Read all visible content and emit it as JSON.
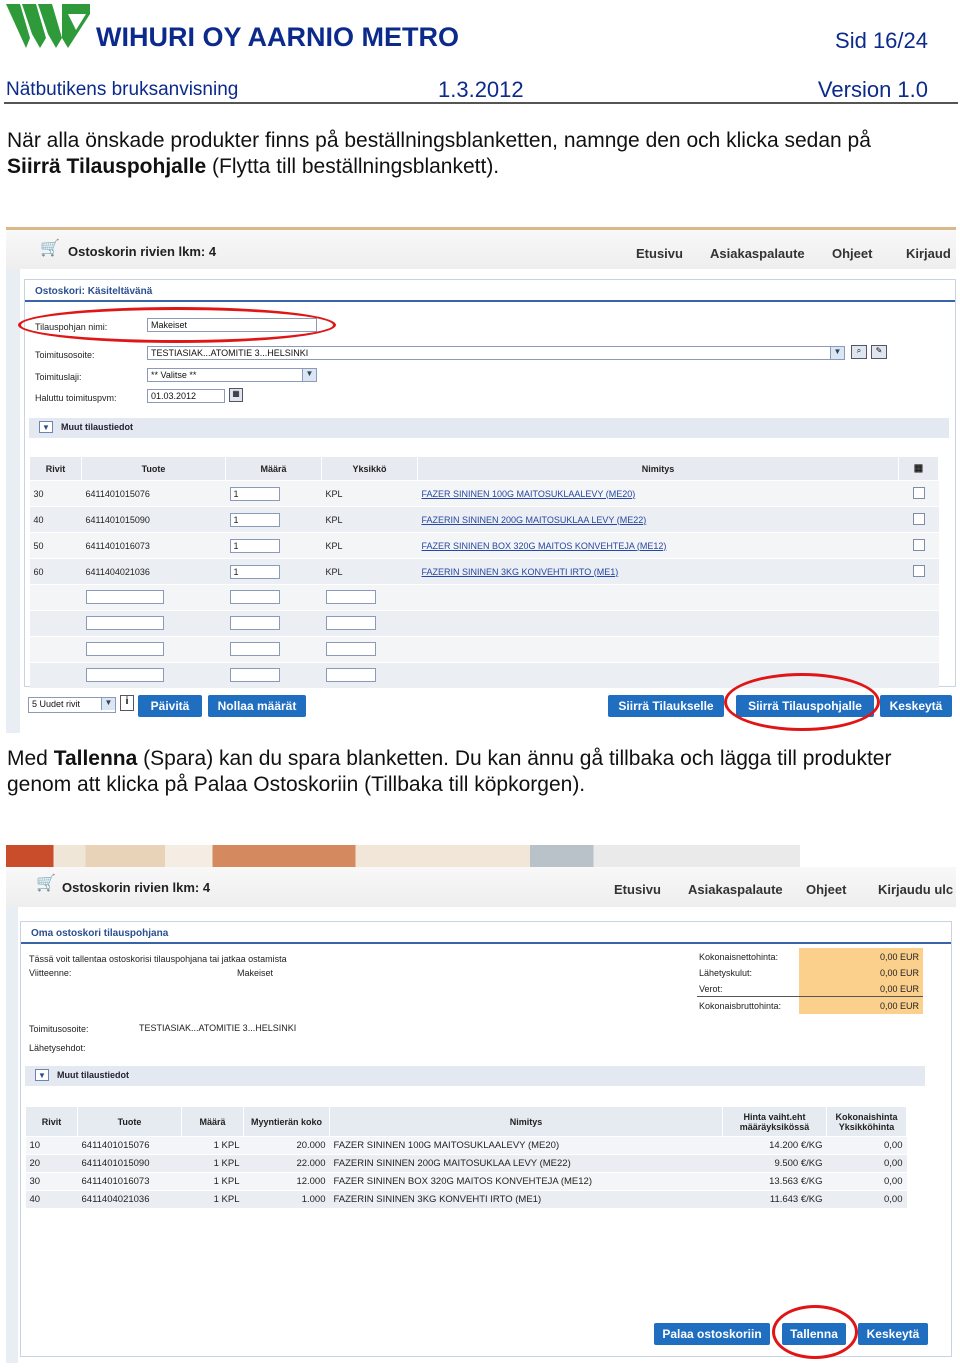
{
  "header": {
    "company": "WIHURI OY AARNIO METRO",
    "page": "Sid 16/24",
    "doc_name": "Nätbutikens bruksanvisning",
    "date": "1.3.2012",
    "version": "Version 1.0"
  },
  "para1": {
    "text1": "När alla önskade produkter finns på beställningsblanketten, namnge den och klicka sedan på",
    "bold": "Siirrä Tilauspohjalle",
    "text2": " (Flytta till beställningsblankett)."
  },
  "shot1": {
    "cart_label": "Ostoskorin rivien lkm: 4",
    "nav": [
      "Etusivu",
      "Asiakaspalaute",
      "Ohjeet",
      "Kirjaud"
    ],
    "panel_title": "Ostoskori: Käsiteltävänä",
    "fields": {
      "name_label": "Tilauspohjan nimi:",
      "name_value": "Makeiset",
      "address_label": "Toimitusosoite:",
      "address_value": "TESTIASIAK...ATOMITIE 3...HELSINKI",
      "delivery_label": "Toimituslaji:",
      "delivery_value": "** Valitse **",
      "date_label": "Haluttu toimituspvm:",
      "date_value": "01.03.2012"
    },
    "more_label": "Muut tilaustiedot",
    "columns": [
      "Rivit",
      "Tuote",
      "Määrä",
      "Yksikkö",
      "Nimitys"
    ],
    "rows": [
      {
        "rivi": "30",
        "tuote": "6411401015076",
        "maara": "1",
        "yks": "KPL",
        "nimi": "FAZER SININEN 100G MAITOSUKLAALEVY (ME20)"
      },
      {
        "rivi": "40",
        "tuote": "6411401015090",
        "maara": "1",
        "yks": "KPL",
        "nimi": "FAZERIN SININEN 200G MAITOSUKLAA LEVY (ME22)"
      },
      {
        "rivi": "50",
        "tuote": "6411401016073",
        "maara": "1",
        "yks": "KPL",
        "nimi": "FAZER SININEN BOX 320G MAITOS KONVEHTEJA (ME12)"
      },
      {
        "rivi": "60",
        "tuote": "6411404021036",
        "maara": "1",
        "yks": "KPL",
        "nimi": "FAZERIN SININEN 3KG KONVEHTI IRTO (ME1)"
      }
    ],
    "new_rows_select": "5 Uudet rivit",
    "buttons": {
      "update": "Päivitä",
      "reset": "Nollaa määrät",
      "to_order": "Siirrä Tilaukselle",
      "to_template": "Siirrä Tilauspohjalle",
      "cancel": "Keskeytä"
    }
  },
  "para2": {
    "t1": "Med ",
    "b1": "Tallenna",
    "t2": " (Spara) kan du spara blanketten. Du kan ännu gå tillbaka och lägga till produkter genom att klicka på Palaa Ostoskoriin (Tillbaka till köpkorgen)."
  },
  "shot2": {
    "cart_label": "Ostoskorin rivien lkm: 4",
    "nav": [
      "Etusivu",
      "Asiakaspalaute",
      "Ohjeet",
      "Kirjaudu ulc"
    ],
    "panel_title": "Oma ostoskori tilauspohjana",
    "intro": "Tässä voit tallentaa ostoskorisi tilauspohjana tai jatkaa ostamista",
    "ref_label": "Viitteenne:",
    "ref_value": "Makeiset",
    "address_label": "Toimitusosoite:",
    "address_value": "TESTIASIAK...ATOMITIE 3...HELSINKI",
    "terms_label": "Lähetysehdot:",
    "summary": [
      {
        "label": "Kokonaisnettohinta:",
        "value": "0,00 EUR"
      },
      {
        "label": "Lähetyskulut:",
        "value": "0,00 EUR"
      },
      {
        "label": "Verot:",
        "value": "0,00 EUR"
      },
      {
        "label": "Kokonaisbruttohinta:",
        "value": "0,00 EUR"
      }
    ],
    "more_label": "Muut tilaustiedot",
    "columns": [
      "Rivit",
      "Tuote",
      "Määrä",
      "Myyntierän koko",
      "Nimitys",
      "Hinta vaiht.eht määräyksikössä",
      "Kokonaishinta Yksikköhinta"
    ],
    "rows": [
      {
        "rivi": "10",
        "tuote": "6411401015076",
        "maara": "1 KPL",
        "era": "20.000",
        "nimi": "FAZER SININEN 100G MAITOSUKLAALEVY (ME20)",
        "hinta": "14.200 €/KG",
        "kok": "0,00"
      },
      {
        "rivi": "20",
        "tuote": "6411401015090",
        "maara": "1 KPL",
        "era": "22.000",
        "nimi": "FAZERIN SININEN 200G MAITOSUKLAA LEVY (ME22)",
        "hinta": "9.500 €/KG",
        "kok": "0,00"
      },
      {
        "rivi": "30",
        "tuote": "6411401016073",
        "maara": "1 KPL",
        "era": "12.000",
        "nimi": "FAZER SININEN BOX 320G MAITOS KONVEHTEJA (ME12)",
        "hinta": "13.563 €/KG",
        "kok": "0,00"
      },
      {
        "rivi": "40",
        "tuote": "6411404021036",
        "maara": "1 KPL",
        "era": "1.000",
        "nimi": "FAZERIN SININEN 3KG KONVEHTI IRTO (ME1)",
        "hinta": "11.643 €/KG",
        "kok": "0,00"
      }
    ],
    "buttons": {
      "back": "Palaa ostoskoriin",
      "save": "Tallenna",
      "cancel": "Keskeytä"
    }
  },
  "colors": {
    "brand_green": "#2e9a3a",
    "brand_blue": "#0b2a8c",
    "button_blue": "#1f6ec0",
    "highlight_red": "#e01515",
    "summary_orange": "#fbd08c"
  }
}
